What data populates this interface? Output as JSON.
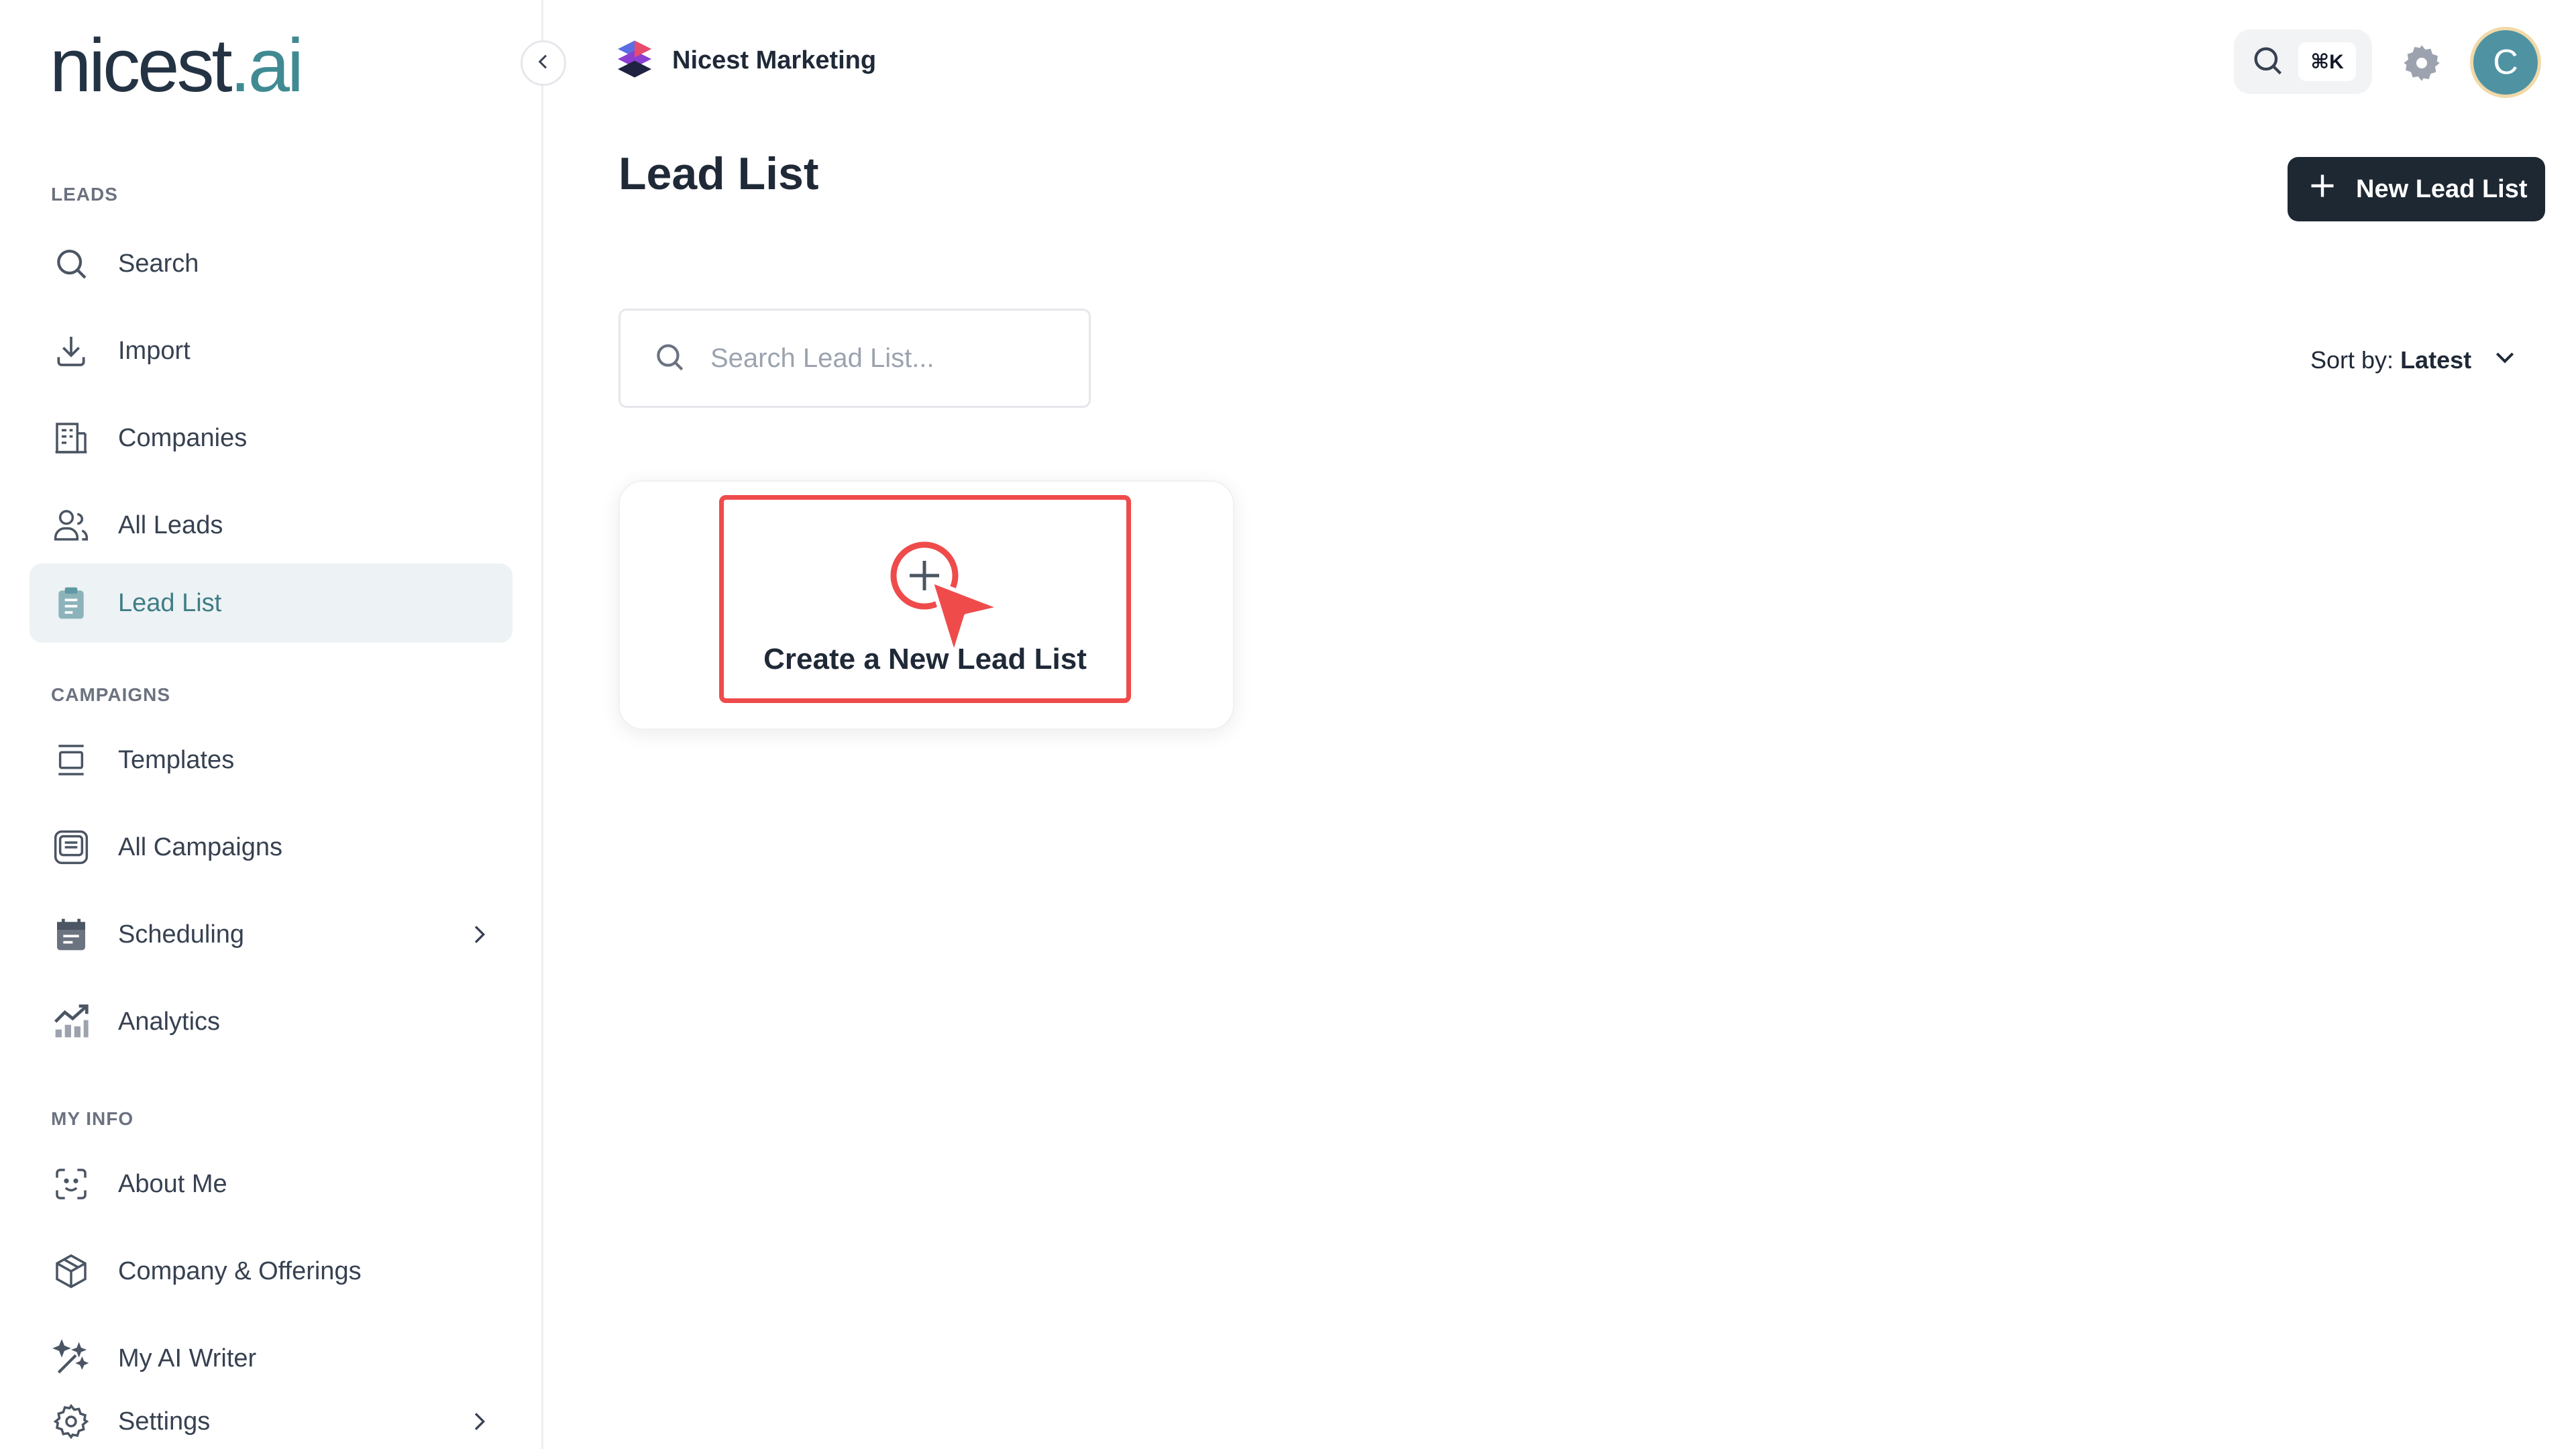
{
  "app": {
    "logo_main": "nicest",
    "logo_dot": ".",
    "logo_ai": "ai"
  },
  "sidebar": {
    "sections": [
      {
        "label": "LEADS"
      },
      {
        "label": "CAMPAIGNS"
      },
      {
        "label": "MY INFO"
      }
    ],
    "items": [
      {
        "label": "Search",
        "icon": "search-icon"
      },
      {
        "label": "Import",
        "icon": "download-icon"
      },
      {
        "label": "Companies",
        "icon": "building-icon"
      },
      {
        "label": "All Leads",
        "icon": "users-icon"
      },
      {
        "label": "Lead List",
        "icon": "clipboard-list-icon",
        "active": true
      },
      {
        "label": "Templates",
        "icon": "template-icon"
      },
      {
        "label": "All Campaigns",
        "icon": "inbox-icon"
      },
      {
        "label": "Scheduling",
        "icon": "calendar-icon",
        "has_submenu": true
      },
      {
        "label": "Analytics",
        "icon": "chart-icon"
      },
      {
        "label": "About Me",
        "icon": "smile-icon"
      },
      {
        "label": "Company & Offerings",
        "icon": "box-icon"
      },
      {
        "label": "My AI Writer",
        "icon": "magic-wand-icon"
      },
      {
        "label": "Settings",
        "icon": "gear-icon",
        "has_submenu": true
      }
    ]
  },
  "header": {
    "workspace": "Nicest Marketing",
    "shortcut": "⌘K",
    "avatar_initial": "C"
  },
  "main": {
    "title": "Lead List",
    "new_button": "New Lead List",
    "search_placeholder": "Search Lead List...",
    "sort_label": "Sort by:",
    "sort_value": "Latest",
    "create_card_label": "Create a New Lead List"
  },
  "colors": {
    "accent": "#3f8a93",
    "dark_button": "#1e2833",
    "highlight": "#ef4b4b",
    "active_bg": "#edf2f4"
  }
}
